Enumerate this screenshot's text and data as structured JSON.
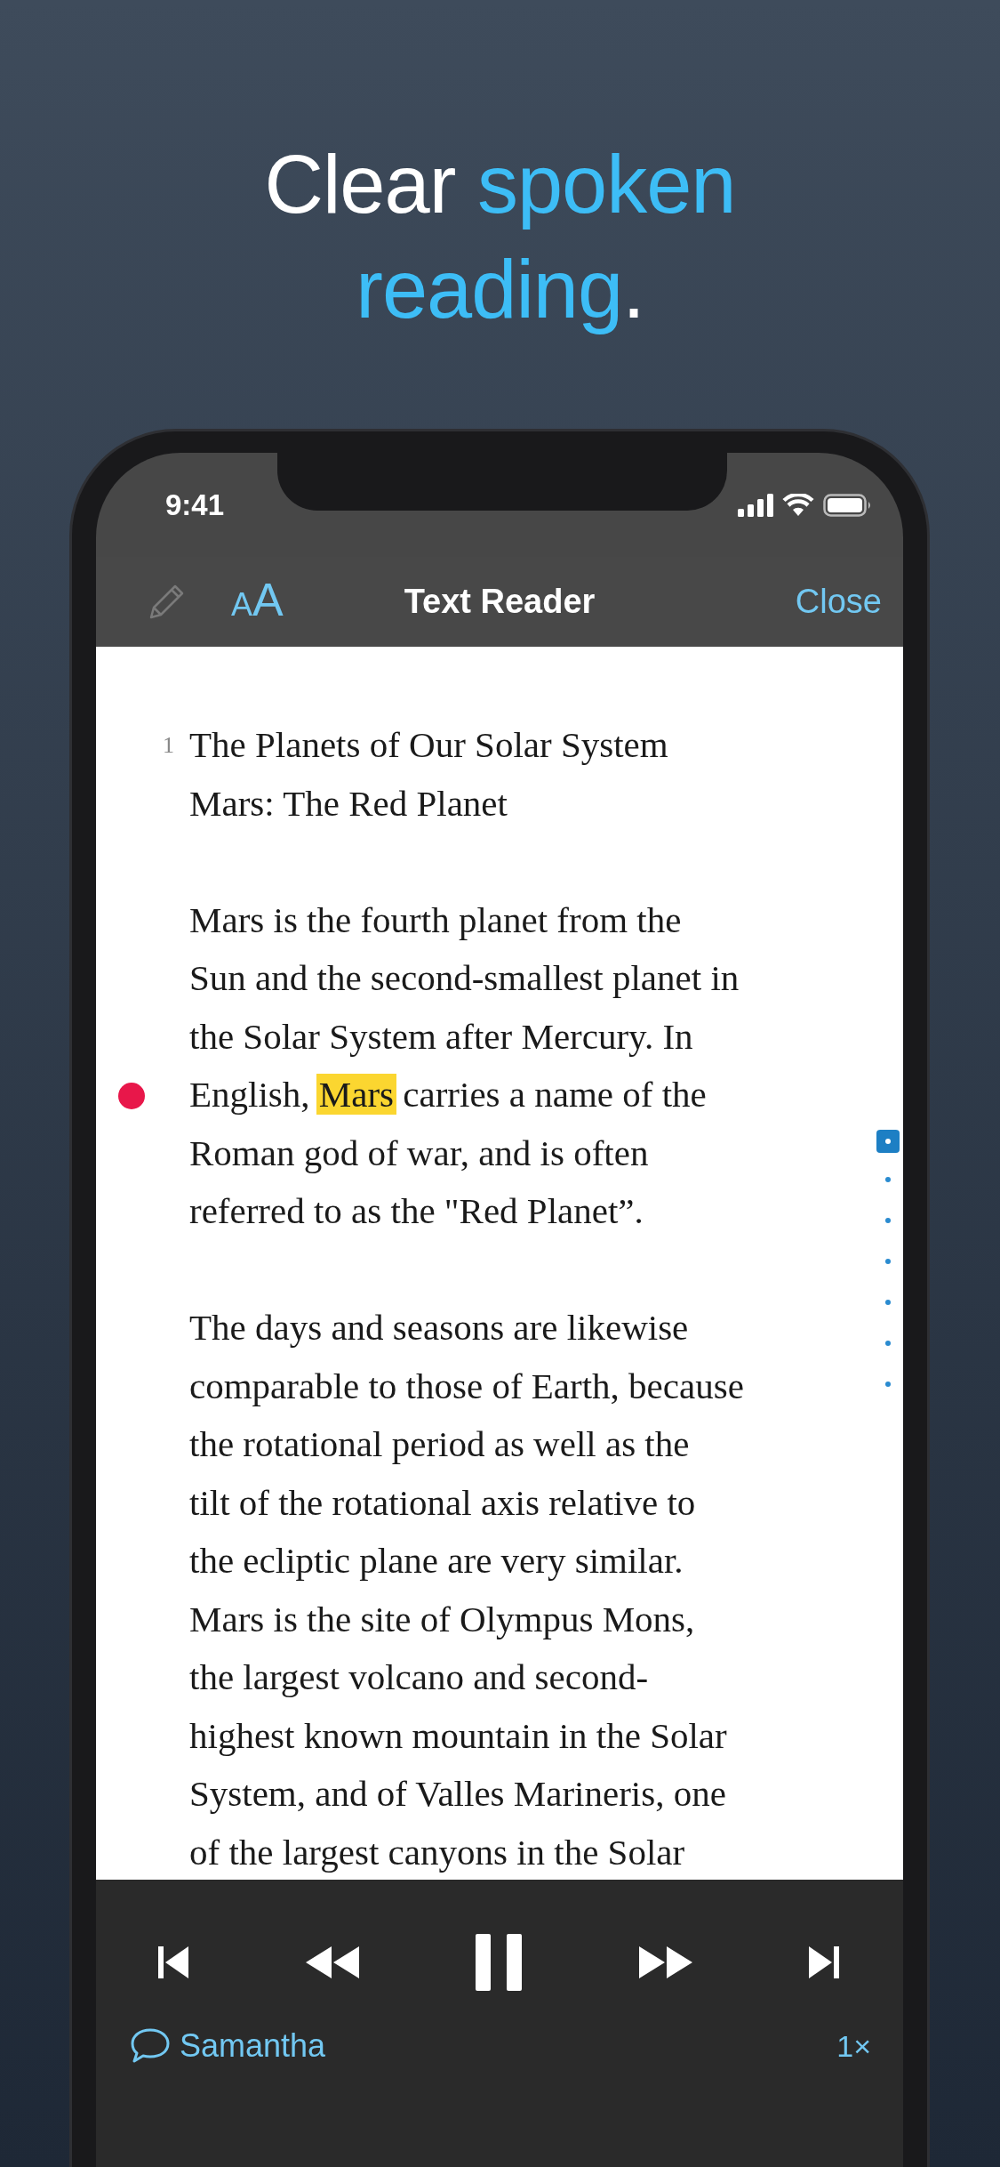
{
  "headline": [
    {
      "text": "Clear ",
      "accent": false
    },
    {
      "text": "spoken reading",
      "accent": true
    },
    {
      "text": ".",
      "accent": false
    }
  ],
  "status_bar": {
    "time": "9:41"
  },
  "nav_bar": {
    "font_button": "AA",
    "title": "Text Reader",
    "close": "Close"
  },
  "document": {
    "line_number": "1",
    "paragraphs": [
      {
        "lines": [
          {
            "current": false,
            "segments": [
              {
                "text": "The Planets of Our Solar System",
                "highlighted": false
              }
            ]
          },
          {
            "current": false,
            "segments": [
              {
                "text": "Mars: The Red Planet",
                "highlighted": false
              }
            ]
          }
        ]
      },
      {
        "lines": [
          {
            "current": false,
            "segments": [
              {
                "text": "Mars is the fourth planet from the",
                "highlighted": false
              }
            ]
          },
          {
            "current": false,
            "segments": [
              {
                "text": "Sun and the second-smallest planet in",
                "highlighted": false
              }
            ]
          },
          {
            "current": false,
            "segments": [
              {
                "text": "the Solar System after Mercury. In",
                "highlighted": false
              }
            ]
          },
          {
            "current": true,
            "segments": [
              {
                "text": "English, ",
                "highlighted": false
              },
              {
                "text": "Mars",
                "highlighted": true
              },
              {
                "text": " carries a name of the",
                "highlighted": false
              }
            ]
          },
          {
            "current": false,
            "segments": [
              {
                "text": "Roman god of war, and is often",
                "highlighted": false
              }
            ]
          },
          {
            "current": false,
            "segments": [
              {
                "text": "referred to as the \"Red Planet”.",
                "highlighted": false
              }
            ]
          }
        ]
      },
      {
        "lines": [
          {
            "current": false,
            "segments": [
              {
                "text": "The days and seasons are likewise",
                "highlighted": false
              }
            ]
          },
          {
            "current": false,
            "segments": [
              {
                "text": "comparable to those of Earth, because",
                "highlighted": false
              }
            ]
          },
          {
            "current": false,
            "segments": [
              {
                "text": "the rotational period as well as the",
                "highlighted": false
              }
            ]
          },
          {
            "current": false,
            "segments": [
              {
                "text": "tilt of the rotational axis relative to",
                "highlighted": false
              }
            ]
          },
          {
            "current": false,
            "segments": [
              {
                "text": "the ecliptic plane are very similar.",
                "highlighted": false
              }
            ]
          },
          {
            "current": false,
            "segments": [
              {
                "text": "Mars is the site of Olympus Mons,",
                "highlighted": false
              }
            ]
          },
          {
            "current": false,
            "segments": [
              {
                "text": "the largest volcano and second-",
                "highlighted": false
              }
            ]
          },
          {
            "current": false,
            "segments": [
              {
                "text": "highest known mountain in the Solar",
                "highlighted": false
              }
            ]
          },
          {
            "current": false,
            "segments": [
              {
                "text": "System, and of Valles Marineris, one",
                "highlighted": false
              }
            ]
          },
          {
            "current": false,
            "segments": [
              {
                "text": "of the largest canyons in the Solar",
                "highlighted": false
              }
            ]
          }
        ]
      }
    ]
  },
  "page_markers": [
    {
      "selected": true
    },
    {
      "selected": false
    },
    {
      "selected": false
    },
    {
      "selected": false
    },
    {
      "selected": false
    },
    {
      "selected": false
    },
    {
      "selected": false
    }
  ],
  "player": {
    "playing": true,
    "voice": "Samantha",
    "speed": "1×"
  }
}
